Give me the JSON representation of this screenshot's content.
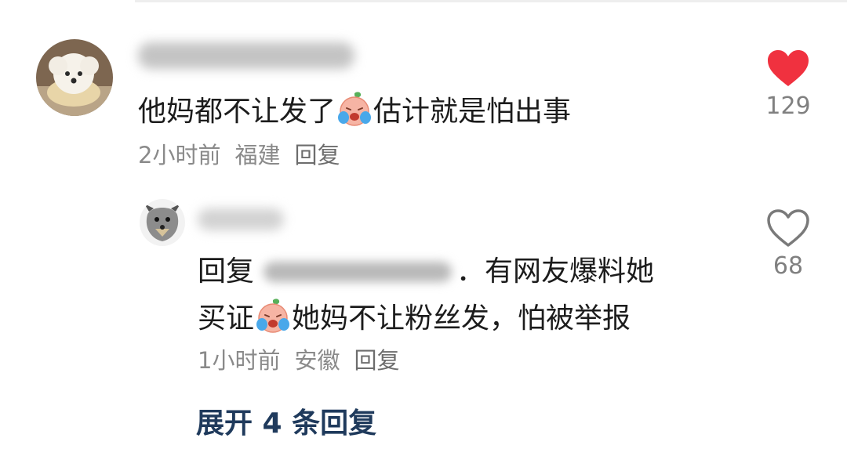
{
  "comment": {
    "text_before_emoji": "他妈都不让发了",
    "emoji": "crying-emoji",
    "text_after_emoji": "估计就是怕出事",
    "time": "2小时前",
    "location": "福建",
    "reply_label": "回复",
    "likes": "129",
    "liked": true
  },
  "reply": {
    "prefix": "回复",
    "line1_after_mention": "．有网友爆料她",
    "line2_before_emoji": "买证",
    "emoji": "crying-emoji",
    "line2_after_emoji": "她妈不让粉丝发，怕被举报",
    "time": "1小时前",
    "location": "安徽",
    "reply_label": "回复",
    "likes": "68",
    "liked": false
  },
  "expand_label": "展开 4 条回复",
  "colors": {
    "like_active": "#f0313f",
    "link": "#1f3a5c",
    "meta_text": "#8a8a8a"
  }
}
